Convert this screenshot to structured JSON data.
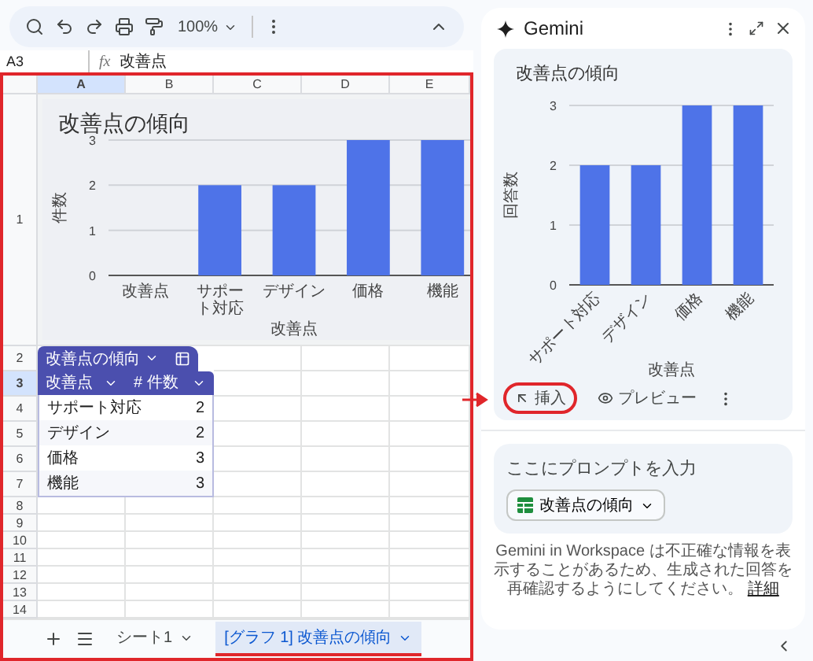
{
  "toolbar": {
    "zoom": "100%"
  },
  "formula_bar": {
    "cell_ref": "A3",
    "fx": "fx",
    "value": "改善点"
  },
  "sheet": {
    "columns": [
      {
        "label": "A",
        "selected": true
      },
      {
        "label": "B",
        "selected": false
      },
      {
        "label": "C",
        "selected": false
      },
      {
        "label": "D",
        "selected": false
      },
      {
        "label": "E",
        "selected": false
      }
    ],
    "rows": [
      {
        "label": "1",
        "selected": false
      },
      {
        "label": "2",
        "selected": false
      },
      {
        "label": "3",
        "selected": true
      },
      {
        "label": "4",
        "selected": false
      },
      {
        "label": "5",
        "selected": false
      },
      {
        "label": "6",
        "selected": false
      },
      {
        "label": "7",
        "selected": false
      },
      {
        "label": "8",
        "selected": false
      },
      {
        "label": "9",
        "selected": false
      },
      {
        "label": "10",
        "selected": false
      },
      {
        "label": "11",
        "selected": false
      },
      {
        "label": "12",
        "selected": false
      },
      {
        "label": "13",
        "selected": false
      },
      {
        "label": "14",
        "selected": false
      }
    ],
    "chart": {
      "chart_data": {
        "type": "bar",
        "title": "改善点の傾向",
        "xlabel": "改善点",
        "ylabel": "件数",
        "categories": [
          "改善点",
          "サポート対応",
          "デザイン",
          "価格",
          "機能"
        ],
        "values": [
          null,
          2,
          2,
          3,
          3
        ],
        "ylim": [
          0,
          3
        ],
        "yticks": [
          {
            "value": 0,
            "label": "0"
          },
          {
            "value": 1,
            "label": "1"
          },
          {
            "value": 2,
            "label": "2"
          },
          {
            "value": 3,
            "label": "3"
          }
        ]
      }
    },
    "table": {
      "name": "改善点の傾向",
      "header_row": [
        {
          "label": "改善点"
        },
        {
          "type_mark": "#",
          "label": "件数"
        }
      ],
      "records": [
        {
          "item": "サポート対応",
          "count": "2"
        },
        {
          "item": "デザイン",
          "count": "2"
        },
        {
          "item": "価格",
          "count": "3"
        },
        {
          "item": "機能",
          "count": "3"
        }
      ]
    }
  },
  "sheet_tabs": [
    {
      "label": "シート1",
      "selected": false
    },
    {
      "label": "[グラフ 1] 改善点の傾向",
      "selected": true
    }
  ],
  "gemini": {
    "title": "Gemini",
    "chart_data": {
      "type": "bar",
      "title": "改善点の傾向",
      "xlabel": "改善点",
      "ylabel": "回答数",
      "categories": [
        "サポート対応",
        "デザイン",
        "価格",
        "機能"
      ],
      "values": [
        2,
        2,
        3,
        3
      ],
      "ylim": [
        0,
        3
      ],
      "yticks": [
        {
          "value": 0,
          "label": "0"
        },
        {
          "value": 1,
          "label": "1"
        },
        {
          "value": 2,
          "label": "2"
        },
        {
          "value": 3,
          "label": "3"
        }
      ]
    },
    "actions": [
      {
        "label": "挿入",
        "highlighted": true
      },
      {
        "label": "プレビュー",
        "highlighted": false
      }
    ],
    "prompt": {
      "placeholder": "ここにプロンプトを入力",
      "chip": "改善点の傾向"
    },
    "disclaimer": "Gemini in Workspace は不正確な情報を表示することがあるため、生成された回答を再確認するようにしてください。",
    "link": "詳細"
  }
}
